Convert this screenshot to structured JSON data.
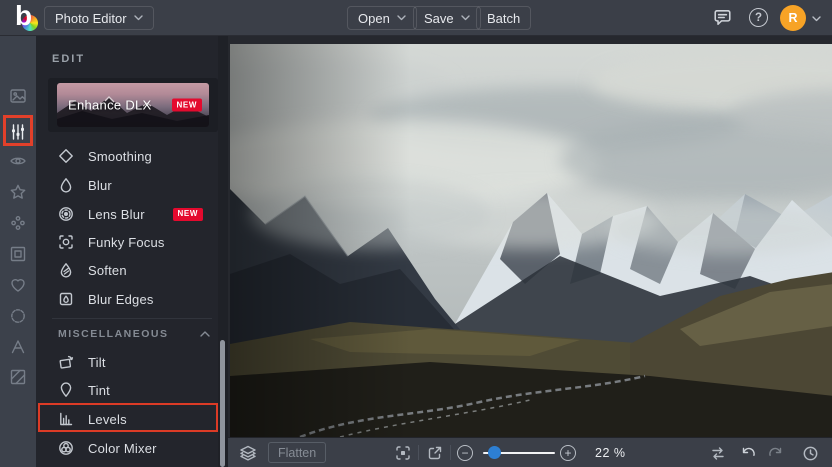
{
  "topbar": {
    "logo_glyph": "b",
    "app_menu_label": "Photo Editor",
    "open_label": "Open",
    "save_label": "Save",
    "batch_label": "Batch",
    "help_glyph": "?",
    "avatar_initial": "R"
  },
  "rail": {
    "items": [
      "photo-manager",
      "edit-sliders",
      "effects-eye",
      "artsy-star",
      "touch-up-dots",
      "frames",
      "overlays-heart",
      "graphics-seal",
      "text",
      "textures"
    ],
    "active_item": "edit-sliders"
  },
  "panel": {
    "header": "EDIT",
    "banner": {
      "title": "Enhance DLX",
      "badge": "NEW"
    },
    "items": [
      {
        "label": "Smoothing",
        "icon": "diamond-icon"
      },
      {
        "label": "Blur",
        "icon": "drop-icon"
      },
      {
        "label": "Lens Blur",
        "icon": "aperture-icon",
        "badge": "NEW"
      },
      {
        "label": "Funky Focus",
        "icon": "focus-icon"
      },
      {
        "label": "Soften",
        "icon": "soften-icon"
      },
      {
        "label": "Blur Edges",
        "icon": "blur-edges-icon"
      }
    ],
    "section_label": "MISCELLANEOUS",
    "misc_items": [
      {
        "label": "Tilt",
        "icon": "tilt-icon"
      },
      {
        "label": "Tint",
        "icon": "tint-icon"
      },
      {
        "label": "Levels",
        "icon": "levels-icon",
        "annotated": true
      },
      {
        "label": "Color Mixer",
        "icon": "color-mixer-icon"
      }
    ]
  },
  "bottombar": {
    "flatten_label": "Flatten",
    "zoom_minus_glyph": "−",
    "zoom_plus_glyph": "+",
    "zoom_percent": "22 %"
  },
  "colors": {
    "annotation_red": "#e2402a",
    "badge_red": "#e40a2e",
    "avatar_orange": "#f7a326",
    "slider_blue": "#2d7fd3",
    "topbar_bg": "#3b3f48",
    "panel_bg": "#23252c"
  }
}
